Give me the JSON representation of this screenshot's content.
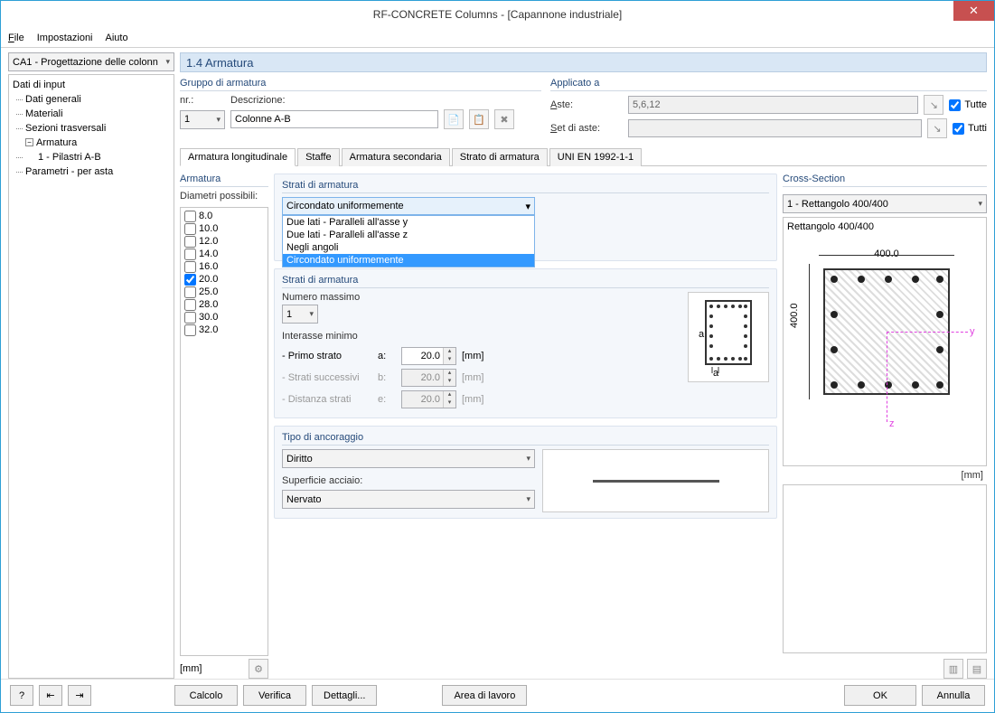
{
  "window": {
    "title": "RF-CONCRETE Columns - [Capannone industriale]"
  },
  "menu": {
    "file": "File",
    "settings": "Impostazioni",
    "help": "Aiuto"
  },
  "leftCombo": "CA1 - Progettazione delle colonn",
  "tree": {
    "root": "Dati di input",
    "n1": "Dati generali",
    "n2": "Materiali",
    "n3": "Sezioni trasversali",
    "n4": "Armatura",
    "n4a": "1 - Pilastri A-B",
    "n5": "Parametri - per asta"
  },
  "pageTitle": "1.4 Armatura",
  "grpArm": {
    "title": "Gruppo di armatura",
    "nrLabel": "nr.:",
    "nrValue": "1",
    "descLabel": "Descrizione:",
    "descValue": "Colonne A-B"
  },
  "applied": {
    "title": "Applicato a",
    "asteLabel": "Aste:",
    "asteValue": "5,6,12",
    "setLabel": "Set di aste:",
    "setValue": "",
    "allLabel": "Tutte",
    "allLabel2": "Tutti"
  },
  "tabs": {
    "t1": "Armatura longitudinale",
    "t2": "Staffe",
    "t3": "Armatura secondaria",
    "t4": "Strato di armatura",
    "t5": "UNI EN 1992-1-1"
  },
  "armatura": {
    "title": "Armatura",
    "diamLabel": "Diametri possibili:",
    "diams": [
      "8.0",
      "10.0",
      "12.0",
      "14.0",
      "16.0",
      "20.0",
      "25.0",
      "28.0",
      "30.0",
      "32.0"
    ],
    "checked": "20.0",
    "unit": "[mm]"
  },
  "strati": {
    "title": "Strati di armatura",
    "ddSelected": "Circondato uniformemente",
    "opts": [
      "Due lati - Paralleli all'asse y",
      "Due lati - Paralleli all'asse z",
      "Negli angoli",
      "Circondato uniformemente"
    ],
    "title2": "Strati di armatura",
    "numMax": "Numero massimo",
    "numVal": "1",
    "interasse": "Interasse minimo",
    "r1": "- Primo strato",
    "r1s": "a:",
    "r1v": "20.0",
    "r2": "- Strati successivi",
    "r2s": "b:",
    "r2v": "20.0",
    "r3": "- Distanza strati",
    "r3s": "e:",
    "r3v": "20.0",
    "mm": "[mm]"
  },
  "anchor": {
    "title": "Tipo di ancoraggio",
    "typeVal": "Diritto",
    "surfLabel": "Superficie acciaio:",
    "surfVal": "Nervato"
  },
  "cs": {
    "title": "Cross-Section",
    "sel": "1 - Rettangolo 400/400",
    "name": "Rettangolo 400/400",
    "dimW": "400.0",
    "dimH": "400.0",
    "y": "y",
    "z": "z",
    "unit": "[mm]"
  },
  "footer": {
    "calc": "Calcolo",
    "ver": "Verifica",
    "det": "Dettagli...",
    "area": "Area di lavoro",
    "ok": "OK",
    "cancel": "Annulla"
  }
}
